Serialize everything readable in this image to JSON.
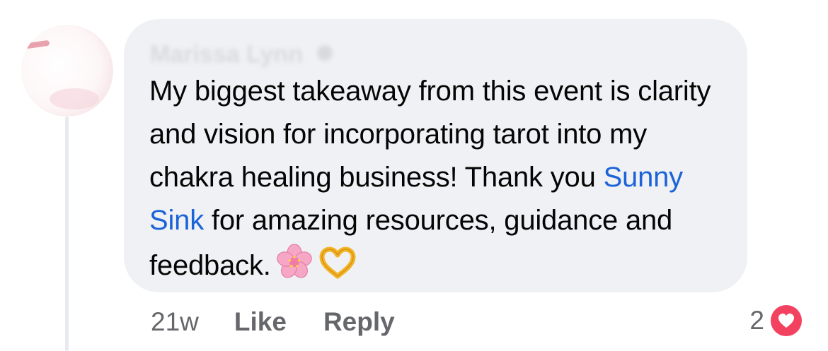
{
  "comment": {
    "author_name": "Marissa Lynn",
    "text_before_mention": "My biggest takeaway from this event is clarity and vision for incorporating tarot into my chakra healing business! Thank you ",
    "mention": "Sunny Sink",
    "text_after_mention": " for amazing resources, guidance and feedback.",
    "emojis": [
      "cherry-blossom-icon",
      "heart-hands-icon"
    ]
  },
  "actions": {
    "timestamp": "21w",
    "like_label": "Like",
    "reply_label": "Reply"
  },
  "reactions": {
    "count": "2",
    "type": "heart-icon"
  },
  "colors": {
    "bubble": "#f0f1f4",
    "mention": "#1b63d8",
    "text": "#050505",
    "meta": "#65676b",
    "heart": "#f3425f"
  }
}
